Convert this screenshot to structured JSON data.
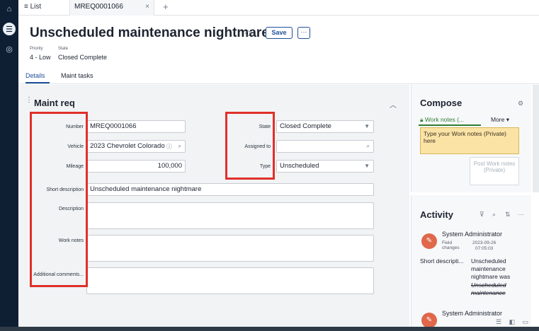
{
  "tabs": {
    "list_label": "≡ List",
    "record_label": "MREQ0001066",
    "close": "×",
    "plus": "+"
  },
  "header": {
    "title": "Unscheduled maintenance nightmare",
    "save_label": "Save",
    "more_label": "···",
    "priority_label": "Priority",
    "priority_value": "4 - Low",
    "state_label": "State",
    "state_value": "Closed Complete"
  },
  "subtabs": [
    "Details",
    "Maint tasks"
  ],
  "form": {
    "section_title": "Maint req",
    "number_label": "Number",
    "number_value": "MREQ0001066",
    "vehicle_label": "Vehicle",
    "vehicle_value": "2023 Chevrolet Colorado",
    "mileage_label": "Mileage",
    "mileage_value": "100,000",
    "state_label": "State",
    "state_value": "Closed Complete",
    "assigned_label": "Assigned to",
    "assigned_value": "",
    "type_label": "Type",
    "type_value": "Unscheduled",
    "short_desc_label": "Short description",
    "short_desc_value": "Unscheduled maintenance nightmare",
    "description_label": "Description",
    "work_notes_label": "Work notes",
    "additional_label": "Additional comments..."
  },
  "compose": {
    "title": "Compose",
    "work_notes_tab": "Work notes (...",
    "more_tab": "More ▾",
    "placeholder": "Type your Work notes (Private) here",
    "post_button": "Post Work notes (Private)"
  },
  "activity": {
    "title": "Activity",
    "entry_author": "System Administrator",
    "entry_type": "Field changes",
    "entry_date": "2023-09-26",
    "entry_time": "07:05:03",
    "field_name": "Short descripti...",
    "new_value": "Unscheduled maintenance nightmare was",
    "old_value": "Unscheduled maintenance",
    "entry2_author": "System Administrator"
  },
  "colors": {
    "accent": "#1f4e99",
    "highlight_box": "#e0302b",
    "work_notes_bg": "#fbe3a6",
    "rail": "#0f1f33"
  }
}
